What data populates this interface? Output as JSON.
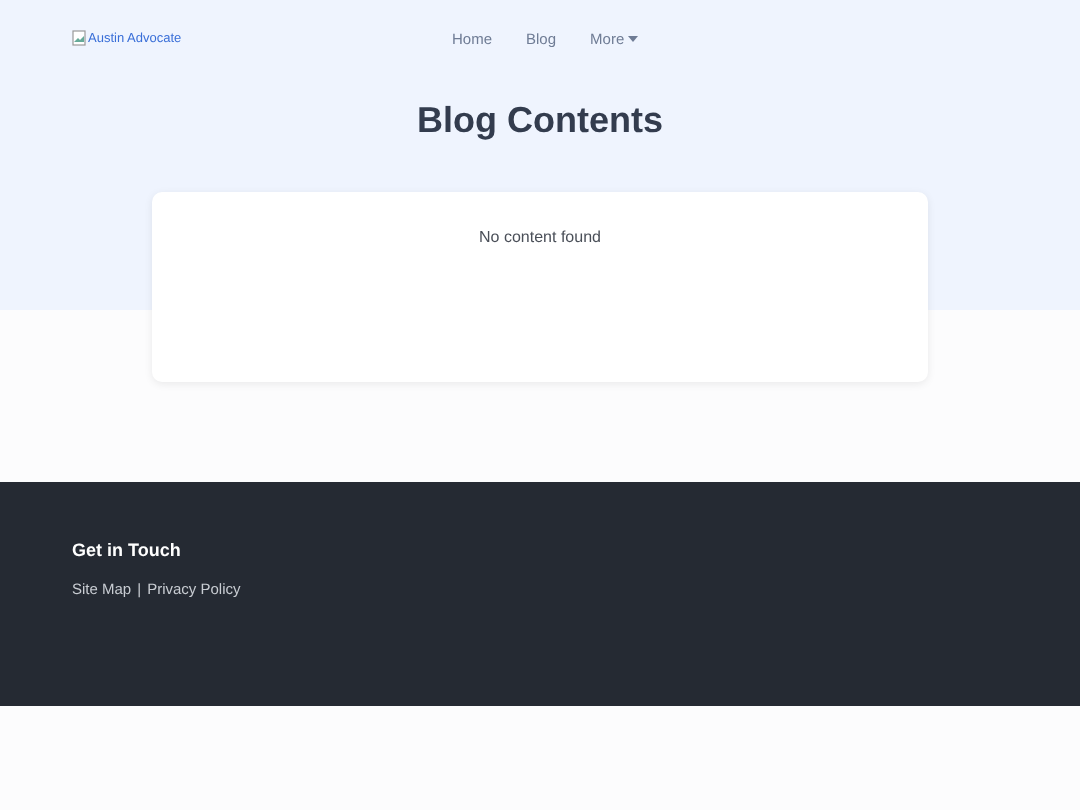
{
  "header": {
    "logo_alt": "Austin Advocate",
    "nav": [
      {
        "label": "Home",
        "kind": "link"
      },
      {
        "label": "Blog",
        "kind": "link"
      },
      {
        "label": "More",
        "kind": "dropdown"
      }
    ]
  },
  "page_title": "Blog Contents",
  "content": {
    "message": "No content found"
  },
  "footer": {
    "heading": "Get in Touch",
    "links": [
      "Site Map",
      "Privacy Policy"
    ],
    "separator": "|"
  }
}
